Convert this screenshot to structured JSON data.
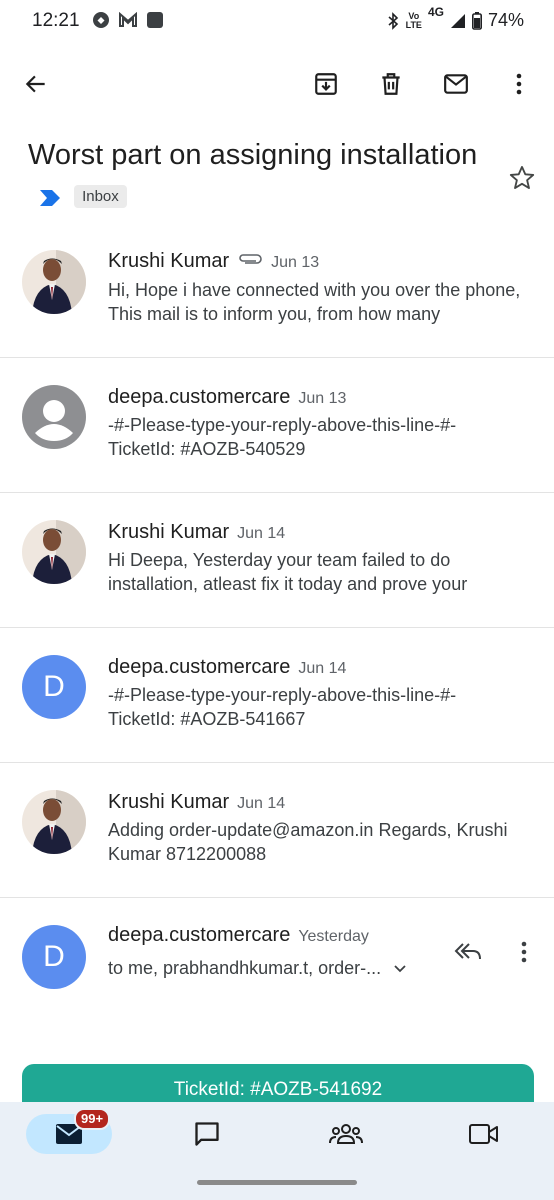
{
  "status_bar": {
    "time": "12:21",
    "network_top": "Vo",
    "network_bottom": "LTE",
    "network_type": "4G",
    "battery": "74%"
  },
  "app_bar": {
    "back_icon": "arrow-left-icon",
    "archive_icon": "archive-icon",
    "delete_icon": "trash-icon",
    "mark_unread_icon": "mail-icon",
    "more_icon": "more-vert-icon"
  },
  "subject": {
    "title": "Worst part on assigning installation",
    "label": "Inbox",
    "importance_color": "#1a73e8"
  },
  "threads": [
    {
      "sender": "Krushi Kumar",
      "date": "Jun 13",
      "has_attachment": true,
      "snippet": "Hi, Hope i have connected with you over the phone, This mail is to inform you, from how many",
      "avatar": "photo"
    },
    {
      "sender": "deepa.customercare",
      "date": "Jun 13",
      "snippet": "-#-Please-type-your-reply-above-this-line-#- TicketId: #AOZB-540529",
      "avatar": "generic"
    },
    {
      "sender": "Krushi Kumar",
      "date": "Jun 14",
      "snippet": "Hi Deepa, Yesterday your team failed to do installation, atleast fix it today and prove your",
      "avatar": "photo"
    },
    {
      "sender": "deepa.customercare",
      "date": "Jun 14",
      "snippet": "-#-Please-type-your-reply-above-this-line-#- TicketId: #AOZB-541667",
      "avatar": "D"
    },
    {
      "sender": "Krushi Kumar",
      "date": "Jun 14",
      "snippet": "Adding order-update@amazon.in Regards, Krushi Kumar 8712200088",
      "avatar": "photo"
    },
    {
      "sender": "deepa.customercare",
      "date": "Yesterday",
      "recipients": "to me, prabhandhkumar.t, order-...",
      "avatar": "D"
    }
  ],
  "ticket_banner": "TicketId: #AOZB-541692",
  "bottom_nav": {
    "mail_badge": "99+",
    "items": [
      "mail-icon",
      "chat-icon",
      "spaces-icon",
      "meet-icon"
    ]
  },
  "colors": {
    "accent_blue": "#5b8def",
    "teal": "#1fa894",
    "badge_red": "#b3261e"
  }
}
